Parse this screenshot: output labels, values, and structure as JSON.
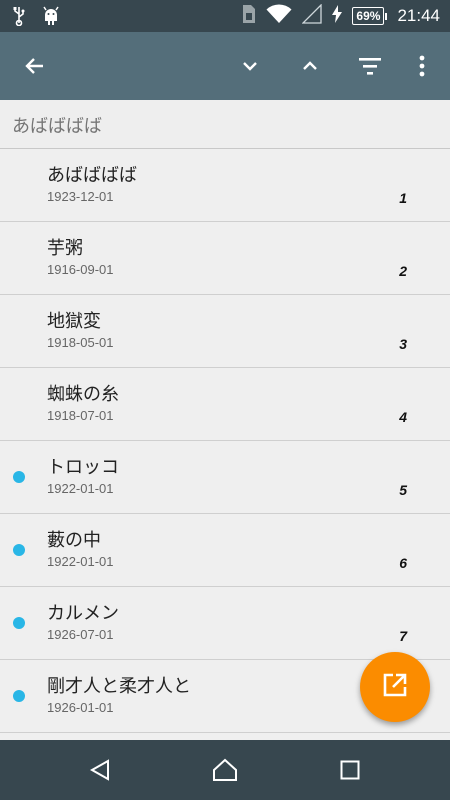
{
  "status_bar": {
    "icons": [
      "usb-icon",
      "android-debug-icon",
      "sim-icon",
      "wifi-icon",
      "signal-icon",
      "charging-icon"
    ],
    "battery_percent": "69%",
    "battery_level": 0.69,
    "time": "21:44"
  },
  "app_bar": {
    "icons": [
      "back-arrow-icon",
      "chevron-down-icon",
      "chevron-up-icon",
      "filter-icon",
      "more-vert-icon"
    ]
  },
  "search": {
    "value": "あばばばば"
  },
  "items": [
    {
      "title": "あばばばば",
      "date": "1923-12-01",
      "number": "1",
      "unread": false
    },
    {
      "title": "芋粥",
      "date": "1916-09-01",
      "number": "2",
      "unread": false
    },
    {
      "title": "地獄変",
      "date": "1918-05-01",
      "number": "3",
      "unread": false
    },
    {
      "title": "蜘蛛の糸",
      "date": "1918-07-01",
      "number": "4",
      "unread": false
    },
    {
      "title": "トロッコ",
      "date": "1922-01-01",
      "number": "5",
      "unread": true
    },
    {
      "title": "藪の中",
      "date": "1922-01-01",
      "number": "6",
      "unread": true
    },
    {
      "title": "カルメン",
      "date": "1926-07-01",
      "number": "7",
      "unread": true
    },
    {
      "title": "剛才人と柔才人と",
      "date": "1926-01-01",
      "number": "",
      "unread": true
    }
  ],
  "colors": {
    "status_bar": "#37474f",
    "app_bar": "#546e7a",
    "fab": "#fb8c00",
    "unread_dot": "#29b6e6"
  },
  "fab": {
    "icon": "open-in-new-icon"
  },
  "nav_bar": {
    "icons": [
      "back-triangle-icon",
      "home-icon",
      "recents-icon"
    ]
  }
}
